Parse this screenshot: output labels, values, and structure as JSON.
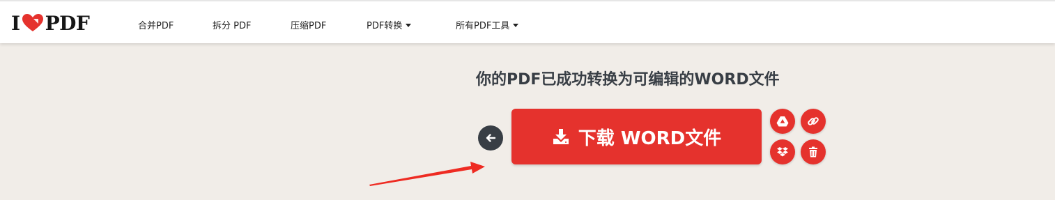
{
  "header": {
    "logo_left": "I",
    "logo_right": "PDF",
    "nav": [
      {
        "label": "合并PDF"
      },
      {
        "label": "拆分 PDF"
      },
      {
        "label": "压缩PDF"
      },
      {
        "label": "PDF转换"
      },
      {
        "label": "所有PDF工具"
      }
    ]
  },
  "main": {
    "heading": "你的PDF已成功转换为可编辑的WORD文件",
    "download_label": "下载 WORD文件"
  },
  "icons": {
    "back": "arrow-left-icon",
    "download": "download-icon",
    "drive": "google-drive-icon",
    "link": "link-icon",
    "dropbox": "dropbox-icon",
    "delete": "trash-icon"
  },
  "colors": {
    "brand_red": "#e5322d",
    "dark": "#383e45",
    "background": "#f1ede8"
  }
}
